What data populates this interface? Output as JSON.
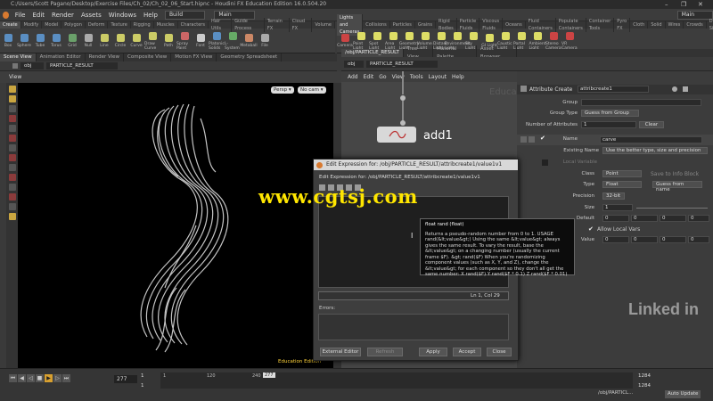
{
  "window": {
    "title": "C:/Users/Scott Pagano/Desktop/Exercise Files/Ch_02/Ch_02_06_Start.hipnc - Houdini FX Education Edition 16.0.504.20",
    "controls": [
      "–",
      "❐",
      "✕"
    ]
  },
  "menu": {
    "items": [
      "File",
      "Edit",
      "Render",
      "Assets",
      "Windows",
      "Help"
    ],
    "desktop_left": "Build",
    "desktop_right": "Main",
    "desktop_far": "Main"
  },
  "shelf_left": {
    "tabs": [
      "Create",
      "Modify",
      "Model",
      "Polygon",
      "Deform",
      "Texture",
      "Rigging",
      "Muscles",
      "Characters",
      "Hair Utils",
      "Guide Process",
      "Terrain FX",
      "Cloud FX",
      "Volume"
    ],
    "tools": [
      "Box",
      "Sphere",
      "Tube",
      "Torus",
      "Grid",
      "Null",
      "Line",
      "Circle",
      "Curve",
      "Draw Curve",
      "Path",
      "Spray Paint",
      "Font",
      "Platonic Solids",
      "L-System",
      "Metaball",
      "File"
    ],
    "colors": [
      "#5a8ec2",
      "#5a8ec2",
      "#5a8ec2",
      "#5a8ec2",
      "#6aa06a",
      "#aaaaaa",
      "#cccc66",
      "#cccc66",
      "#cccc66",
      "#cccc66",
      "#cccc66",
      "#cc6666",
      "#cccccc",
      "#5a8ec2",
      "#66aa66",
      "#cc8866",
      "#aaaaaa"
    ]
  },
  "shelf_right": {
    "tabs": [
      "Lights and Cameras",
      "Collisions",
      "Particles",
      "Grains",
      "Rigid Bodies",
      "Particle Fluids",
      "Viscous Fluids",
      "Oceans",
      "Fluid Containers",
      "Populate Containers",
      "Container Tools",
      "Pyro FX",
      "Cloth",
      "Solid",
      "Wires",
      "Crowds",
      "Drive Simulation"
    ],
    "tools": [
      "Camera",
      "Point Light",
      "Spot Light",
      "Area Light",
      "Geometry Light",
      "Volume Light",
      "Distant Light",
      "Environment Light",
      "Sky Light",
      "GI Light",
      "Caustic Light",
      "Portal Light",
      "Ambient Light",
      "Stereo Camera",
      "VR Camera"
    ],
    "colors": [
      "#cc4444",
      "#dddd66",
      "#dddd66",
      "#dddd66",
      "#dddd66",
      "#dddd66",
      "#dddd66",
      "#dddd66",
      "#dddd66",
      "#dddd66",
      "#dddd66",
      "#dddd66",
      "#dddd66",
      "#cc4444",
      "#cc4444"
    ]
  },
  "left_pane": {
    "tabs": [
      "Scene View",
      "Animation Editor",
      "Render View",
      "Composite View",
      "Motion FX View",
      "Geometry Spreadsheet"
    ],
    "path_root": "obj",
    "path_node": "PARTICLE_RESULT",
    "view_label": "View",
    "persp": "Persp ▾",
    "cam": "No cam ▾",
    "edu_label": "Education Edition"
  },
  "center_pane": {
    "tabs": [
      "/obj/PARTICLE_RESULT",
      "Tree View",
      "Material Palette",
      "Asset Browser"
    ],
    "path_root": "obj",
    "path_node": "PARTICLE_RESULT",
    "menu": [
      "Add",
      "Edit",
      "Go",
      "View",
      "Tools",
      "Layout",
      "Help"
    ],
    "node_name": "add1",
    "bg_text": "Educa"
  },
  "params": {
    "node_type": "Attribute Create",
    "node_name": "attribcreate1",
    "group_label": "Group",
    "group_type_label": "Group Type",
    "group_type_value": "Guess from Group",
    "num_attr_label": "Number of Attributes",
    "num_attr_value": "1",
    "clear_label": "Clear",
    "name_label": "Name",
    "name_value": "carve",
    "existing_label": "Existing Name",
    "existing_value": "Use the better type, size and precision",
    "local_var_label": "Local Variable",
    "class_label": "Class",
    "class_value": "Point",
    "save_info": "Save to Info Block",
    "type_label": "Type",
    "type_value": "Float",
    "guess_label": "Guess from name",
    "precision_label": "Precision",
    "precision_value": "32-bit",
    "size_label": "Size",
    "size_value": "1",
    "default_label": "Default",
    "default_values": [
      "0",
      "0",
      "0",
      "0"
    ],
    "allow_local": "Allow Local Vars",
    "value_label": "Value",
    "value_values": [
      "0",
      "0",
      "0",
      "0"
    ]
  },
  "dialog": {
    "title": "Edit Expression for: /obj/PARTICLE_RESULT/attribcreate1/value1v1",
    "subtitle": "Edit Expression for: /obj/PARTICLE_RESULT/attribcreate1/value1v1",
    "status": "Ln 1, Col 29",
    "errors_label": "Errors:",
    "buttons": [
      "External Editor",
      "Refresh",
      "Apply",
      "Accept",
      "Close"
    ]
  },
  "tooltip": {
    "header": "float rand (float)",
    "body": "Returns a pseudo-random number from 0 to 1. USAGE rand(&lt;value&gt;) Using the same &lt;value&gt; always gives the same result. To vary the result, base the &lt;value&gt; on a changing number (usually the current frame $F). &gt; rand($F) When you're randomizing component values (such as X, Y, and Z), change the &lt;value&gt; for each component so they don't all get the same number: X rand($F) Y rand($F * 0.1) Z rand($F * 0.01)"
  },
  "watermark": "www.cgtsj.com",
  "brand": "Linked in",
  "timeline": {
    "frame": "277",
    "start": "1",
    "start2": "1",
    "ticks": [
      "1",
      "120",
      "240",
      "277"
    ],
    "end": "1284",
    "end2": "1284",
    "auto_update": "Auto Update",
    "path": "/obj/PARTICL..."
  }
}
